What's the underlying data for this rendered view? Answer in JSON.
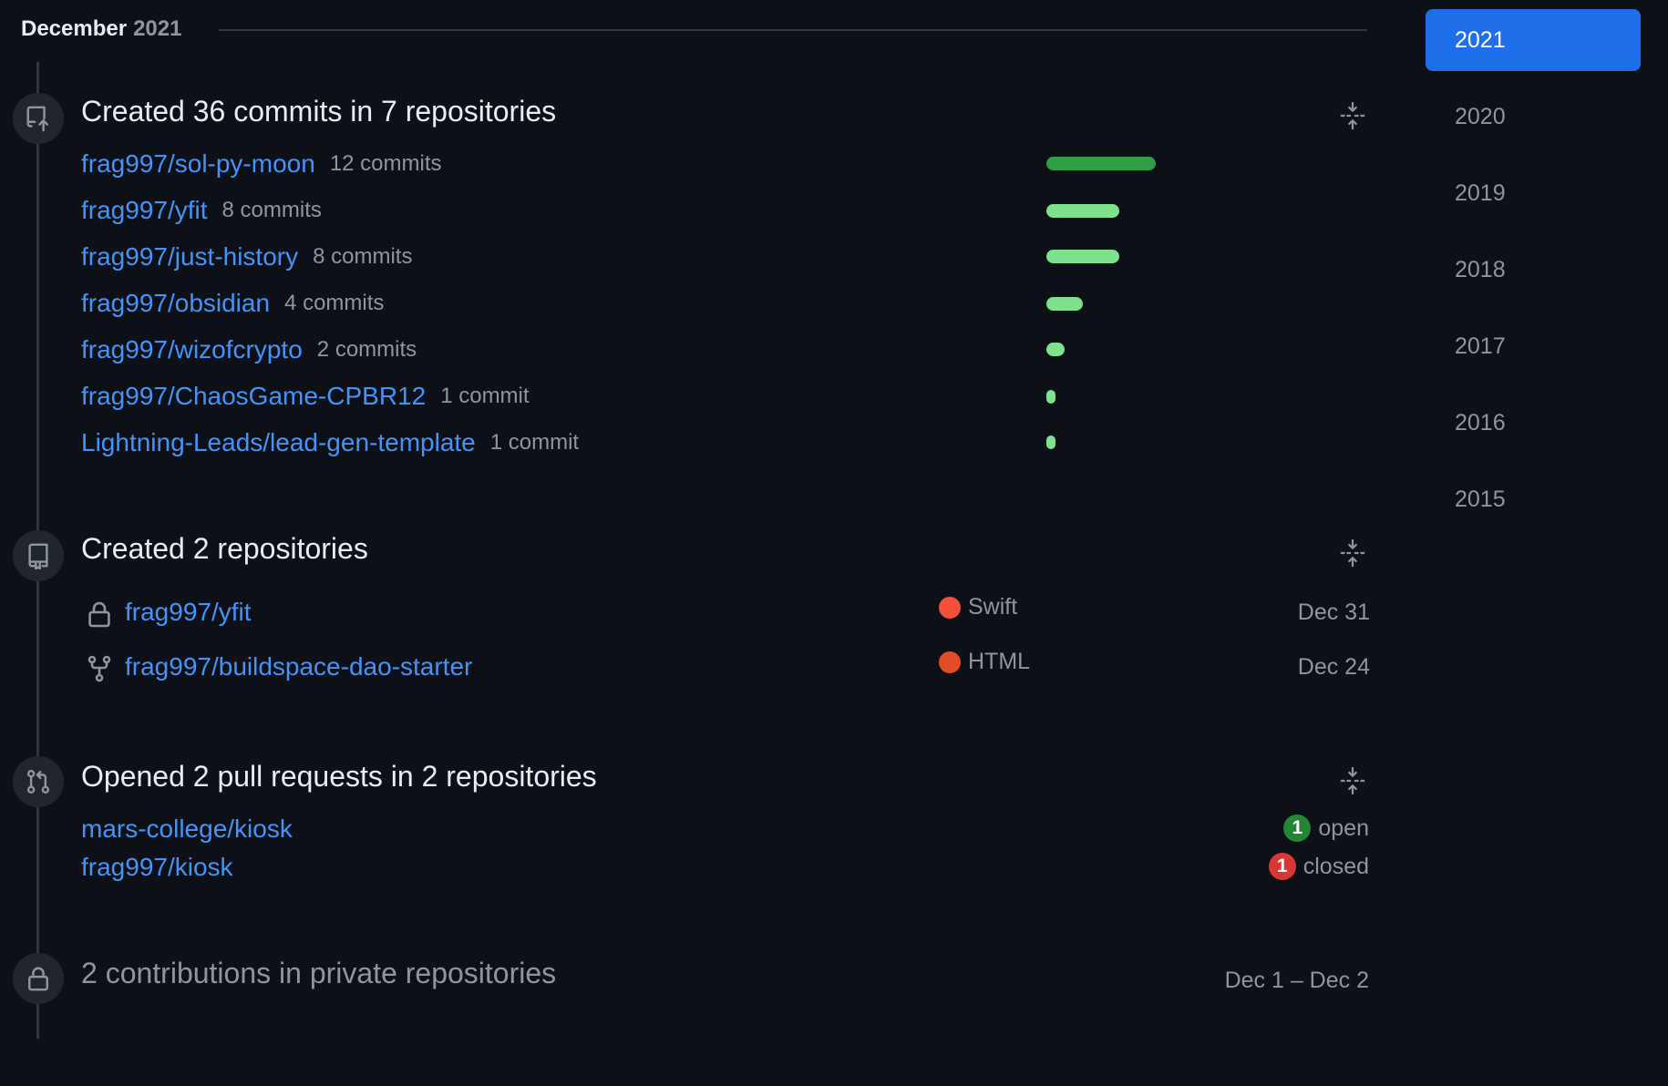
{
  "month_header": {
    "month": "December",
    "year": "2021"
  },
  "commits_section": {
    "title": "Created 36 commits in 7 repositories",
    "repos": [
      {
        "name": "frag997/sol-py-moon",
        "count_label": "12 commits",
        "commits": 12
      },
      {
        "name": "frag997/yfit",
        "count_label": "8 commits",
        "commits": 8
      },
      {
        "name": "frag997/just-history",
        "count_label": "8 commits",
        "commits": 8
      },
      {
        "name": "frag997/obsidian",
        "count_label": "4 commits",
        "commits": 4
      },
      {
        "name": "frag997/wizofcrypto",
        "count_label": "2 commits",
        "commits": 2
      },
      {
        "name": "frag997/ChaosGame-CPBR12",
        "count_label": "1 commit",
        "commits": 1
      },
      {
        "name": "Lightning-Leads/lead-gen-template",
        "count_label": "1 commit",
        "commits": 1
      }
    ],
    "bar_colors": {
      "high": "#2ea043",
      "normal": "#7ee18d"
    }
  },
  "repos_section": {
    "title": "Created 2 repositories",
    "repos": [
      {
        "icon": "lock-icon",
        "name": "frag997/yfit",
        "language": "Swift",
        "language_color": "#f05138",
        "date": "Dec 31"
      },
      {
        "icon": "repo-forked-icon",
        "name": "frag997/buildspace-dao-starter",
        "language": "HTML",
        "language_color": "#e34c26",
        "date": "Dec 24"
      }
    ]
  },
  "pull_requests_section": {
    "title": "Opened 2 pull requests in 2 repositories",
    "repos": [
      {
        "name": "mars-college/kiosk",
        "count": "1",
        "state": "open",
        "state_color": "#238636"
      },
      {
        "name": "frag997/kiosk",
        "count": "1",
        "state": "closed",
        "state_color": "#da3633"
      }
    ]
  },
  "private_section": {
    "title": "2 contributions in private repositories",
    "date_range": "Dec 1 – Dec 2"
  },
  "year_nav": {
    "years": [
      "2021",
      "2020",
      "2019",
      "2018",
      "2017",
      "2016",
      "2015"
    ],
    "selected": "2021",
    "accent_color": "#1f6feb"
  }
}
